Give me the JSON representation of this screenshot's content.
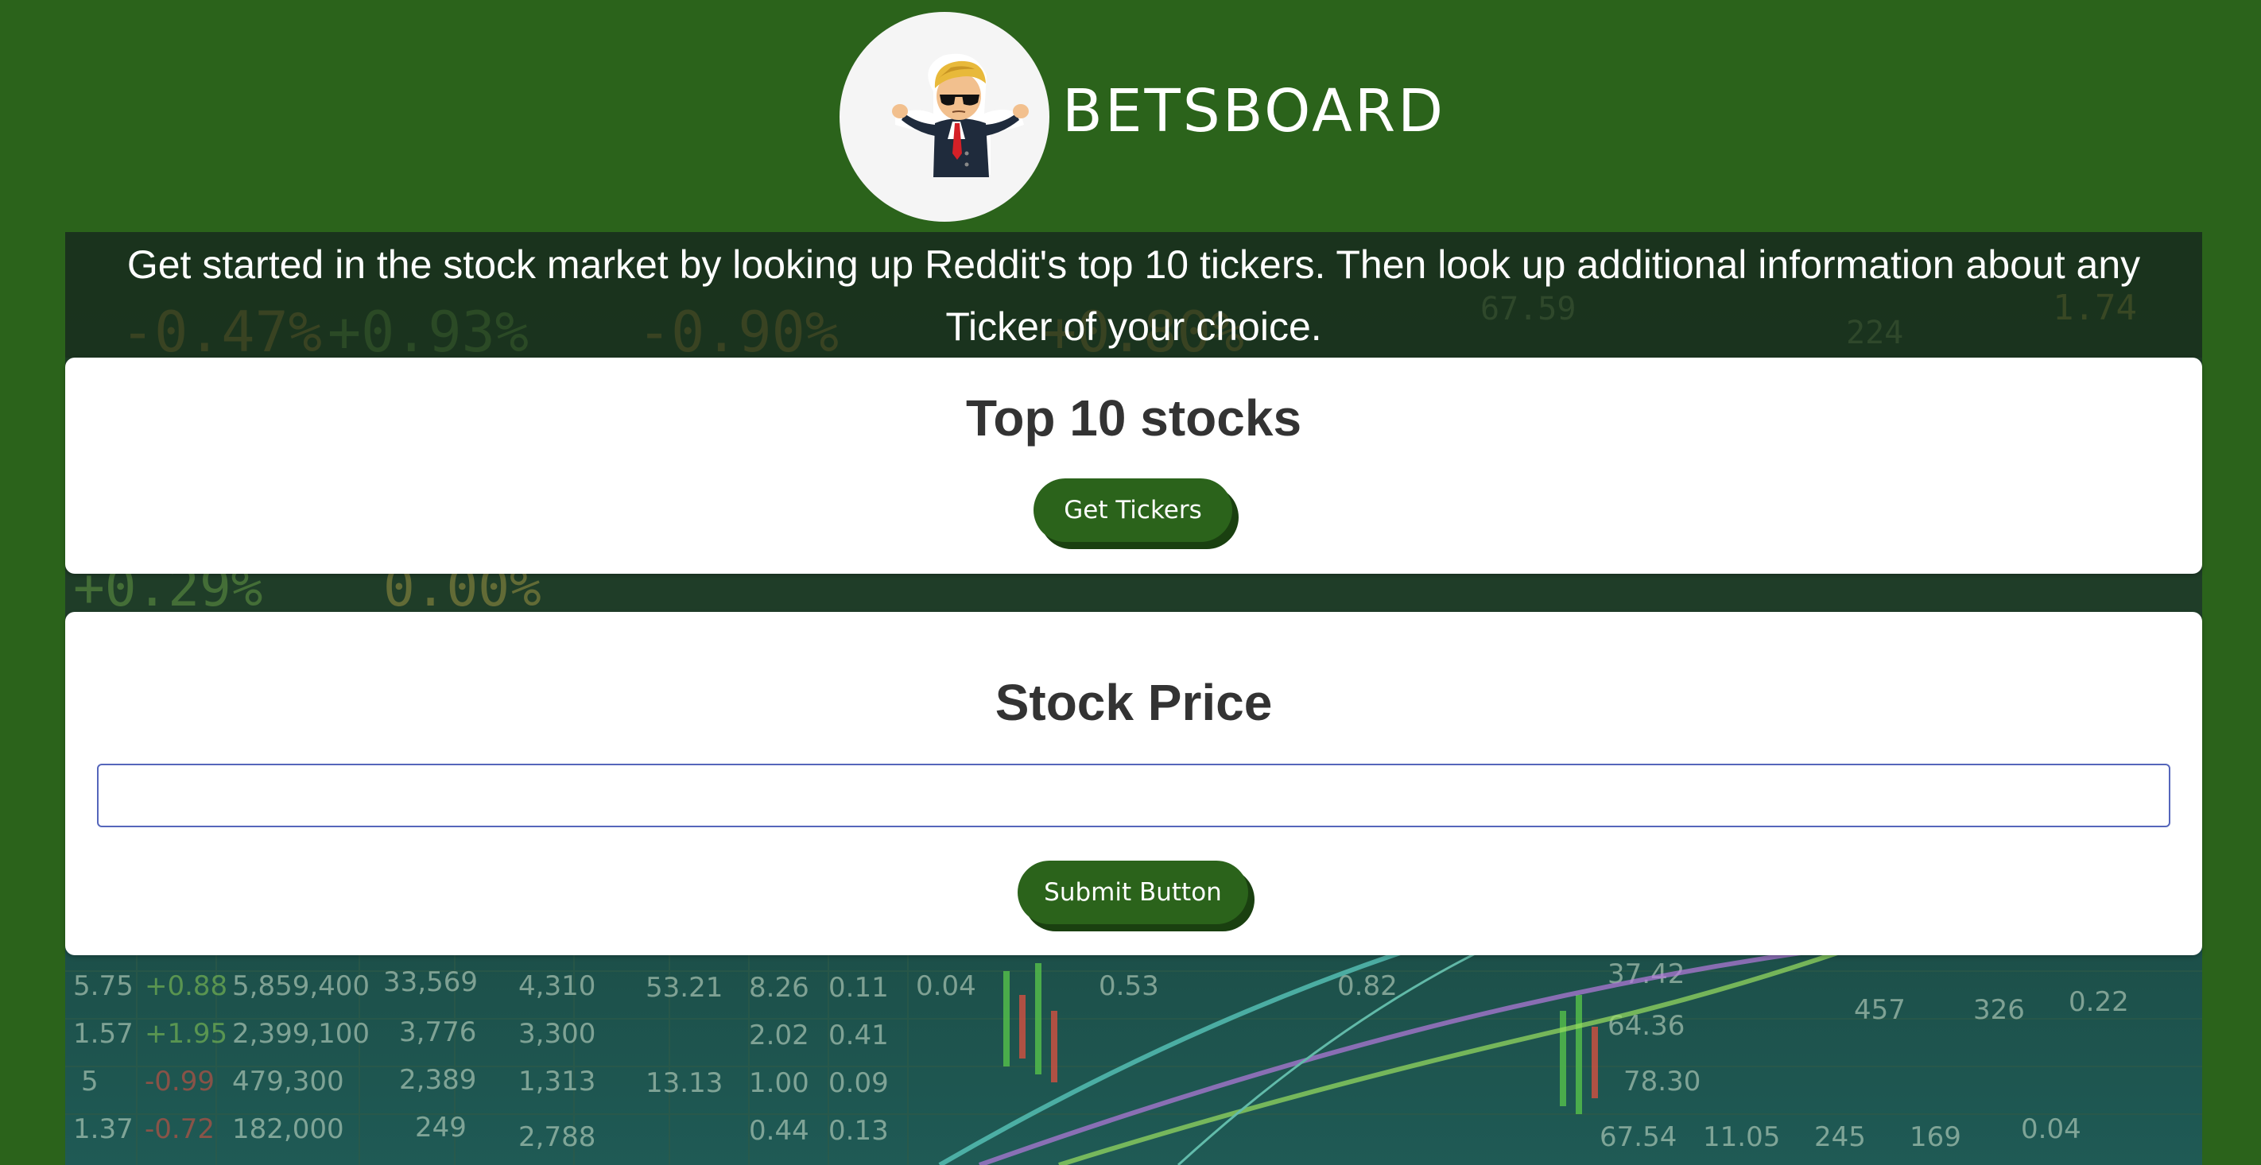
{
  "header": {
    "brand_title": "BETSBOARD",
    "logo_icon": "wsb-mascot-icon"
  },
  "intro": {
    "text": "Get started in the stock market by looking up Reddit's top 10 tickers. Then look up additional information about any Ticker of your choice."
  },
  "top10_card": {
    "title": "Top 10 stocks",
    "button_label": "Get Tickers"
  },
  "price_card": {
    "title": "Stock Price",
    "input_value": "",
    "input_placeholder": "",
    "button_label": "Submit Button"
  },
  "colors": {
    "brand_green": "#2b631b",
    "button_shadow": "#1a4010",
    "card_background": "#ffffff",
    "title_text": "#333333",
    "input_border": "#5566bb"
  }
}
